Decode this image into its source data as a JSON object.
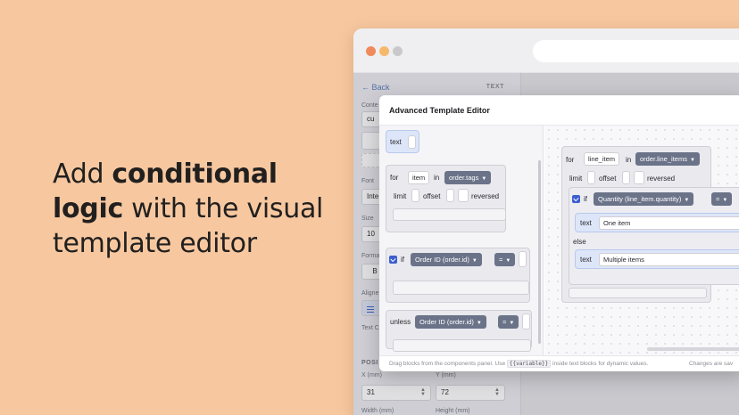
{
  "hero": {
    "line1_pre": "Add ",
    "line1_bold": "conditional",
    "line2_bold": "logic",
    "line2_post": " with the visual",
    "line3": "template editor"
  },
  "sidebar": {
    "back": "← Back",
    "panel_label": "TEXT",
    "content_label": "Conte",
    "content_value": "cu",
    "font_label": "Font",
    "font_value": "Inte",
    "size_label": "Size",
    "size_value": "10",
    "format_label": "Forma",
    "format_value": "B",
    "align_label": "Aligne",
    "text_color_label": "Text C",
    "position_label": "POSI",
    "x_label": "X (mm)",
    "x_value": "31",
    "y_label": "Y (mm)",
    "y_value": "72",
    "width_label": "Width (mm)",
    "height_label": "Height (mm)"
  },
  "modal": {
    "title": "Advanced Template Editor",
    "footer_pre": "Drag blocks from the components panel. Use ",
    "footer_code": "{{variable}}",
    "footer_post": " inside text blocks for dynamic values.",
    "footer_right": "Changes are sav"
  },
  "palette": {
    "text_block": "text",
    "for_kw": "for",
    "for_var": "item",
    "in_kw": "in",
    "for_source": "order.tags",
    "limit": "limit",
    "offset": "offset",
    "reversed": "reversed",
    "if_kw": "if",
    "if_field": "Order ID  (order.id)",
    "if_op": "=",
    "unless_kw": "unless",
    "unless_field": "Order ID  (order.id)",
    "unless_op": "="
  },
  "workspace": {
    "for_kw": "for",
    "for_var": "line_item",
    "in_kw": "in",
    "for_source": "line_item",
    "for_source_full": "order.line_items",
    "limit": "limit",
    "offset": "offset",
    "reversed": "reversed",
    "if_kw": "if",
    "if_field": "Quantity  (line_item.quantity)",
    "if_op": "=",
    "text_kw": "text",
    "then_value": "One item",
    "else_kw": "else",
    "else_value": "Multiple items"
  },
  "icons": [
    "arrow-left-icon",
    "chevron-down-icon",
    "condition-check-icon"
  ],
  "colors": {
    "background": "#f7c8a0",
    "dropdown": "#6b7389",
    "condition": "#3c5fce",
    "text_block": "#dde6f8"
  }
}
